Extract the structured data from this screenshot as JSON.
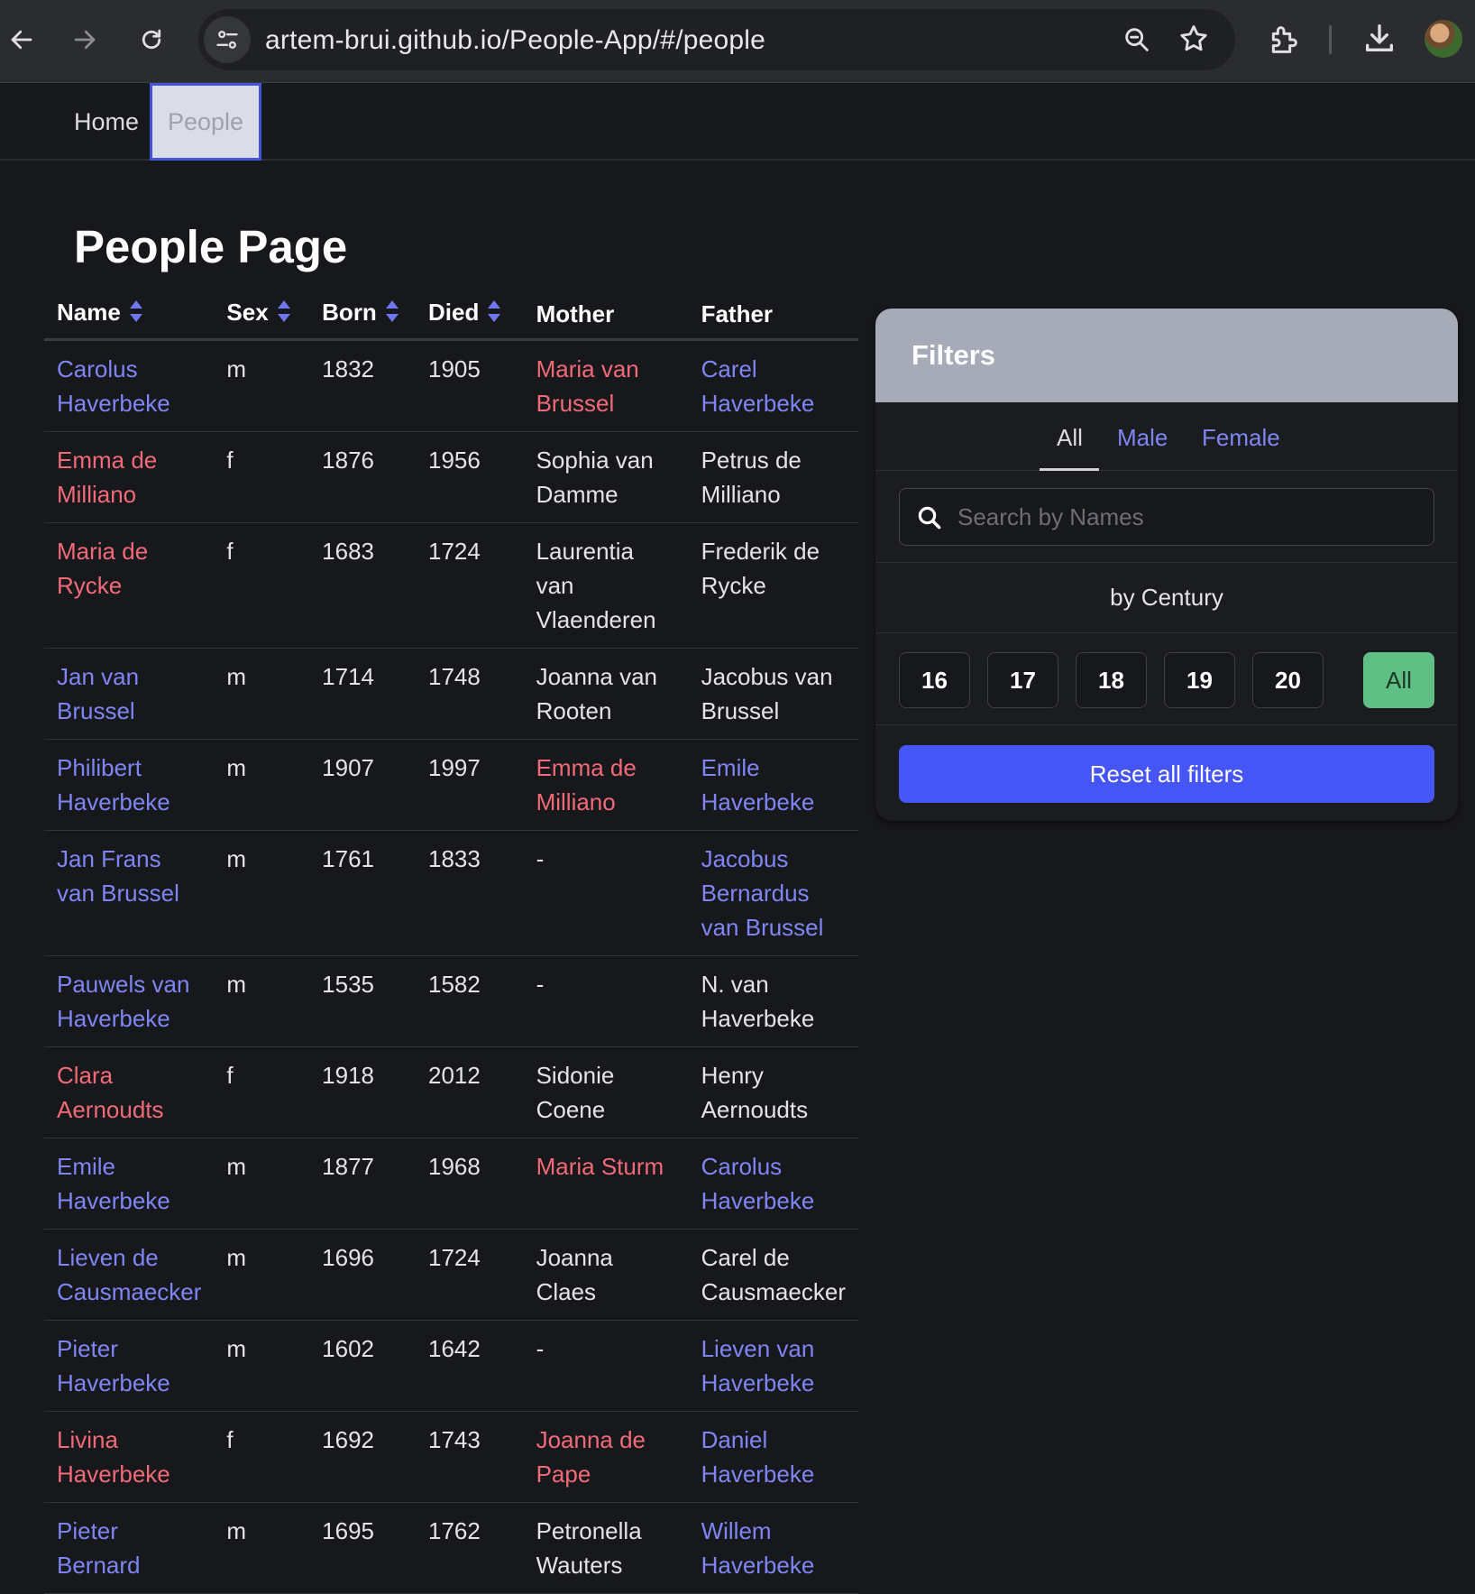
{
  "browser": {
    "url": "artem-brui.github.io/People-App/#/people"
  },
  "nav": {
    "home": "Home",
    "people": "People"
  },
  "page": {
    "title": "People Page"
  },
  "table": {
    "headers": [
      "Name",
      "Sex",
      "Born",
      "Died",
      "Mother",
      "Father"
    ],
    "rows": [
      {
        "name": "Carolus Haverbeke",
        "sex": "m",
        "born": "1832",
        "died": "1905",
        "mother": "Maria van Brussel",
        "mother_link": "f",
        "father": "Carel Haverbeke",
        "father_link": "m"
      },
      {
        "name": "Emma de Milliano",
        "sex": "f",
        "born": "1876",
        "died": "1956",
        "mother": "Sophia van Damme",
        "mother_link": "",
        "father": "Petrus de Milliano",
        "father_link": ""
      },
      {
        "name": "Maria de Rycke",
        "sex": "f",
        "born": "1683",
        "died": "1724",
        "mother": "Laurentia van Vlaenderen",
        "mother_link": "",
        "father": "Frederik de Rycke",
        "father_link": ""
      },
      {
        "name": "Jan van Brussel",
        "sex": "m",
        "born": "1714",
        "died": "1748",
        "mother": "Joanna van Rooten",
        "mother_link": "",
        "father": "Jacobus van Brussel",
        "father_link": ""
      },
      {
        "name": "Philibert Haverbeke",
        "sex": "m",
        "born": "1907",
        "died": "1997",
        "mother": "Emma de Milliano",
        "mother_link": "f",
        "father": "Emile Haverbeke",
        "father_link": "m"
      },
      {
        "name": "Jan Frans van Brussel",
        "sex": "m",
        "born": "1761",
        "died": "1833",
        "mother": "-",
        "mother_link": "",
        "father": "Jacobus Bernardus van Brussel",
        "father_link": "m"
      },
      {
        "name": "Pauwels van Haverbeke",
        "sex": "m",
        "born": "1535",
        "died": "1582",
        "mother": "-",
        "mother_link": "",
        "father": "N. van Haverbeke",
        "father_link": ""
      },
      {
        "name": "Clara Aernoudts",
        "sex": "f",
        "born": "1918",
        "died": "2012",
        "mother": "Sidonie Coene",
        "mother_link": "",
        "father": "Henry Aernoudts",
        "father_link": ""
      },
      {
        "name": "Emile Haverbeke",
        "sex": "m",
        "born": "1877",
        "died": "1968",
        "mother": "Maria Sturm",
        "mother_link": "f",
        "father": "Carolus Haverbeke",
        "father_link": "m"
      },
      {
        "name": "Lieven de Causmaecker",
        "sex": "m",
        "born": "1696",
        "died": "1724",
        "mother": "Joanna Claes",
        "mother_link": "",
        "father": "Carel de Causmaecker",
        "father_link": ""
      },
      {
        "name": "Pieter Haverbeke",
        "sex": "m",
        "born": "1602",
        "died": "1642",
        "mother": "-",
        "mother_link": "",
        "father": "Lieven van Haverbeke",
        "father_link": "m"
      },
      {
        "name": "Livina Haverbeke",
        "sex": "f",
        "born": "1692",
        "died": "1743",
        "mother": "Joanna de Pape",
        "mother_link": "f",
        "father": "Daniel Haverbeke",
        "father_link": "m"
      },
      {
        "name": "Pieter Bernard",
        "sex": "m",
        "born": "1695",
        "died": "1762",
        "mother": "Petronella Wauters",
        "mother_link": "",
        "father": "Willem Haverbeke",
        "father_link": "m"
      }
    ]
  },
  "filters": {
    "title": "Filters",
    "tabs": {
      "all": "All",
      "male": "Male",
      "female": "Female"
    },
    "search_placeholder": "Search by Names",
    "century_label": "by Century",
    "centuries": [
      "16",
      "17",
      "18",
      "19",
      "20"
    ],
    "century_all": "All",
    "reset": "Reset all filters"
  },
  "colors": {
    "male_link": "#7f86f4",
    "female_link": "#f26a78",
    "active_century": "#5fbf85",
    "reset_button": "#4655f5"
  }
}
